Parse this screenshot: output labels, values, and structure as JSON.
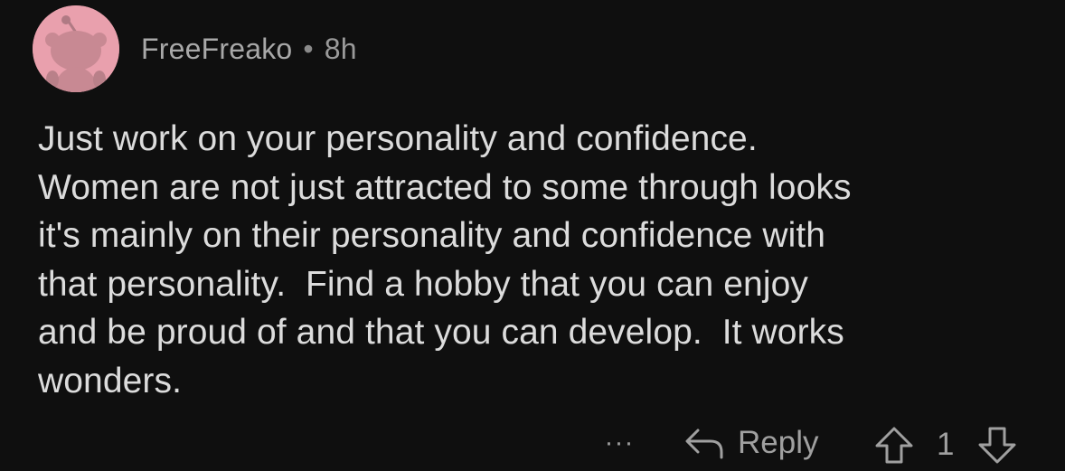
{
  "comment": {
    "author": "FreeFreako",
    "separator": "•",
    "age": "8h",
    "text": "Just work on your personality and confidence.\nWomen are not just attracted to some through looks\nit's mainly on their personality and confidence with\nthat personality.  Find a hobby that you can enjoy\nand be proud of and that you can develop.  It works\nwonders.",
    "avatar_icon": "snoo-avatar-icon",
    "avatar_bg": "#e9a0ad"
  },
  "actions": {
    "more_label": "···",
    "more_icon": "more-options-icon",
    "reply_label": "Reply",
    "reply_icon": "reply-arrow-icon",
    "upvote_icon": "upvote-arrow-icon",
    "vote_count": "1",
    "downvote_icon": "downvote-arrow-icon"
  },
  "colors": {
    "background": "#0f0f0f",
    "text": "#dcdcdc",
    "muted": "#9a9a9a"
  }
}
